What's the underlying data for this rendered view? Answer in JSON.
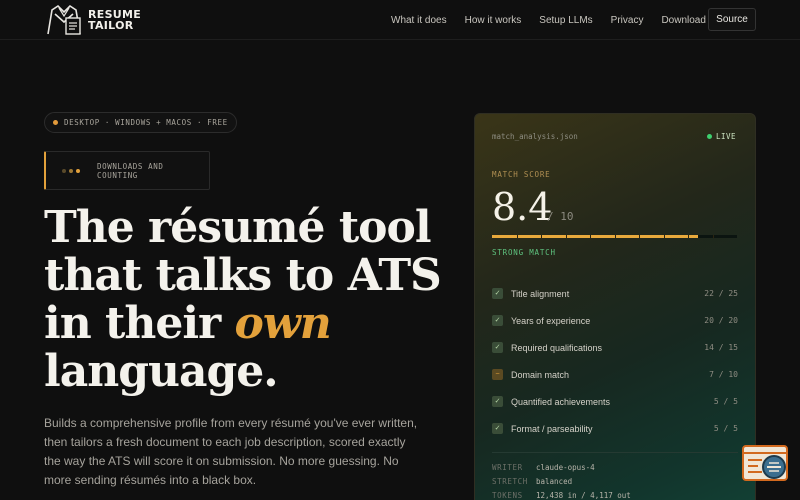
{
  "brand": {
    "name_line1": "RESUME",
    "name_line2": "TAILOR"
  },
  "nav": {
    "links": [
      "What it does",
      "How it works",
      "Setup LLMs",
      "Privacy",
      "Download"
    ],
    "source_label": "Source"
  },
  "hero": {
    "badge": "DESKTOP · WINDOWS + MACOS · FREE",
    "counter": "DOWNLOADS AND COUNTING",
    "headline": {
      "line1": "The résumé tool",
      "line2": "that talks to ATS",
      "line3_prefix": "in their ",
      "line3_accent": "own",
      "line4": "language."
    },
    "subcopy": "Builds a comprehensive profile from every résumé you've ever written, then tailors a fresh document to each job description, scored exactly the way the ATS will score it on submission. No more guessing. No more sending résumés into a black box."
  },
  "card": {
    "filename": "match_analysis.json",
    "live_label": "LIVE",
    "match_score_label": "MATCH SCORE",
    "score": "8.4",
    "score_max": "/ 10",
    "score_fraction": 0.84,
    "strength_label": "STRONG MATCH",
    "criteria": [
      {
        "label": "Title alignment",
        "score": "22 / 25",
        "status": "ok",
        "mark": "✓"
      },
      {
        "label": "Years of experience",
        "score": "20 / 20",
        "status": "ok",
        "mark": "✓"
      },
      {
        "label": "Required qualifications",
        "score": "14 / 15",
        "status": "ok",
        "mark": "✓"
      },
      {
        "label": "Domain match",
        "score": "7 / 10",
        "status": "warn",
        "mark": "~"
      },
      {
        "label": "Quantified achievements",
        "score": "5 / 5",
        "status": "ok",
        "mark": "✓"
      },
      {
        "label": "Format / parseability",
        "score": "5 / 5",
        "status": "ok",
        "mark": "✓"
      }
    ],
    "meta": [
      {
        "key": "WRITER",
        "value": "claude-opus-4"
      },
      {
        "key": "STRETCH",
        "value": "balanced"
      },
      {
        "key": "TOKENS",
        "value": "12,438 in / 4,117 out"
      }
    ]
  },
  "colors": {
    "accent": "#e3a13b",
    "live": "#3ecf6e",
    "strong": "#5ec27f",
    "counter_dots": [
      "#5a4a2a",
      "#a07a35",
      "#e3a13b"
    ]
  }
}
